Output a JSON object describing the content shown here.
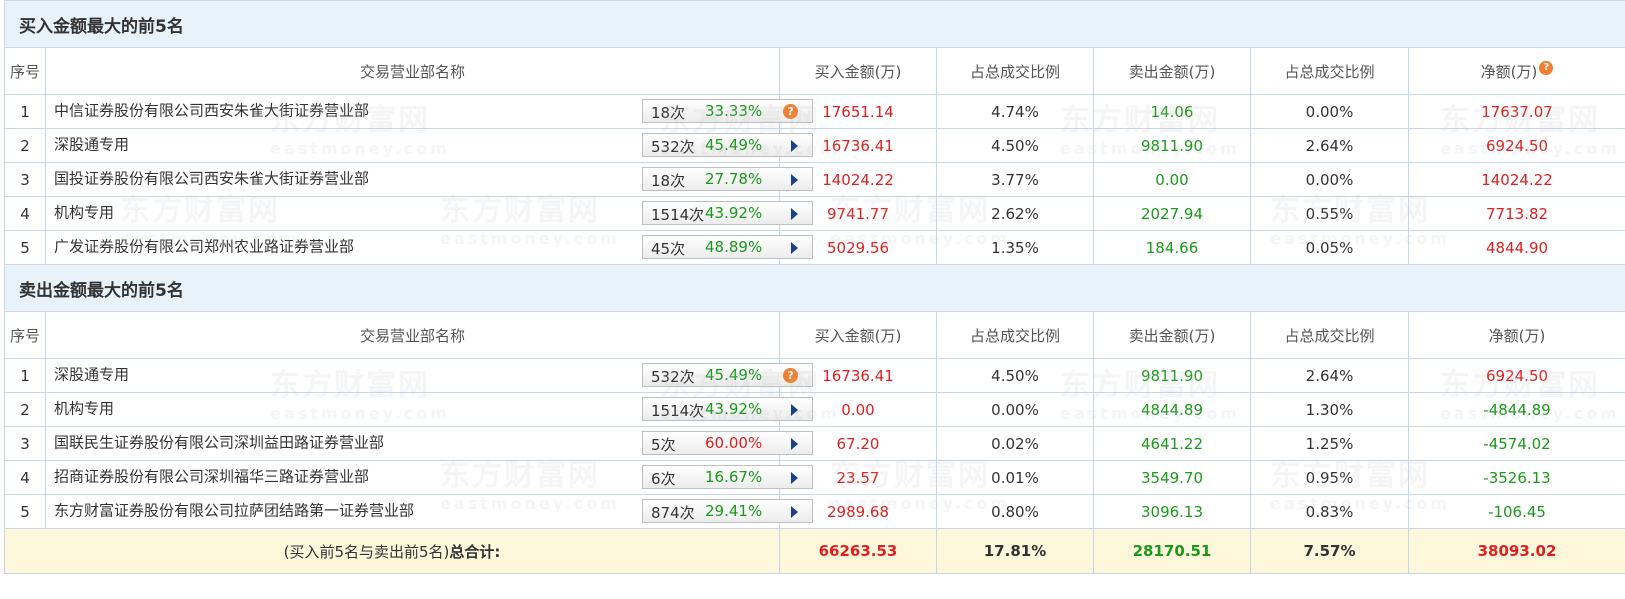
{
  "watermark": {
    "text": "东方财富网",
    "sub": "eastmoney.com"
  },
  "headers": [
    "序号",
    "交易营业部名称",
    "买入金额(万)",
    "占总成交比例",
    "卖出金额(万)",
    "占总成交比例",
    "净额(万)"
  ],
  "info_icon": "question-icon",
  "buy_section": {
    "title": "买入金额最大的前5名",
    "rows": [
      {
        "idx": "1",
        "name": "中信证券股份有限公司西安朱雀大街证券营业部",
        "count": "18次",
        "rate": "33.33%",
        "rate_color": "green",
        "icon": "question",
        "buy": "17651.14",
        "buy_ratio": "4.74%",
        "sell": "14.06",
        "sell_ratio": "0.00%",
        "net": "17637.07",
        "net_color": "red"
      },
      {
        "idx": "2",
        "name": "深股通专用",
        "count": "532次",
        "rate": "45.49%",
        "rate_color": "green",
        "icon": "arrow",
        "buy": "16736.41",
        "buy_ratio": "4.50%",
        "sell": "9811.90",
        "sell_ratio": "2.64%",
        "net": "6924.50",
        "net_color": "red"
      },
      {
        "idx": "3",
        "name": "国投证券股份有限公司西安朱雀大街证券营业部",
        "count": "18次",
        "rate": "27.78%",
        "rate_color": "green",
        "icon": "arrow",
        "buy": "14024.22",
        "buy_ratio": "3.77%",
        "sell": "0.00",
        "sell_ratio": "0.00%",
        "net": "14024.22",
        "net_color": "red"
      },
      {
        "idx": "4",
        "name": "机构专用",
        "count": "1514次",
        "rate": "43.92%",
        "rate_color": "green",
        "icon": "arrow",
        "buy": "9741.77",
        "buy_ratio": "2.62%",
        "sell": "2027.94",
        "sell_ratio": "0.55%",
        "net": "7713.82",
        "net_color": "red"
      },
      {
        "idx": "5",
        "name": "广发证券股份有限公司郑州农业路证券营业部",
        "count": "45次",
        "rate": "48.89%",
        "rate_color": "green",
        "icon": "arrow",
        "buy": "5029.56",
        "buy_ratio": "1.35%",
        "sell": "184.66",
        "sell_ratio": "0.05%",
        "net": "4844.90",
        "net_color": "red"
      }
    ]
  },
  "sell_section": {
    "title": "卖出金额最大的前5名",
    "rows": [
      {
        "idx": "1",
        "name": "深股通专用",
        "count": "532次",
        "rate": "45.49%",
        "rate_color": "green",
        "icon": "question",
        "buy": "16736.41",
        "buy_ratio": "4.50%",
        "sell": "9811.90",
        "sell_ratio": "2.64%",
        "net": "6924.50",
        "net_color": "red"
      },
      {
        "idx": "2",
        "name": "机构专用",
        "count": "1514次",
        "rate": "43.92%",
        "rate_color": "green",
        "icon": "arrow",
        "buy": "0.00",
        "buy_ratio": "0.00%",
        "sell": "4844.89",
        "sell_ratio": "1.30%",
        "net": "-4844.89",
        "net_color": "green"
      },
      {
        "idx": "3",
        "name": "国联民生证券股份有限公司深圳益田路证券营业部",
        "count": "5次",
        "rate": "60.00%",
        "rate_color": "red",
        "icon": "arrow",
        "buy": "67.20",
        "buy_ratio": "0.02%",
        "sell": "4641.22",
        "sell_ratio": "1.25%",
        "net": "-4574.02",
        "net_color": "green"
      },
      {
        "idx": "4",
        "name": "招商证券股份有限公司深圳福华三路证券营业部",
        "count": "6次",
        "rate": "16.67%",
        "rate_color": "green",
        "icon": "arrow",
        "buy": "23.57",
        "buy_ratio": "0.01%",
        "sell": "3549.70",
        "sell_ratio": "0.95%",
        "net": "-3526.13",
        "net_color": "green"
      },
      {
        "idx": "5",
        "name": "东方财富证券股份有限公司拉萨团结路第一证券营业部",
        "count": "874次",
        "rate": "29.41%",
        "rate_color": "green",
        "icon": "arrow",
        "buy": "2989.68",
        "buy_ratio": "0.80%",
        "sell": "3096.13",
        "sell_ratio": "0.83%",
        "net": "-106.45",
        "net_color": "green"
      }
    ]
  },
  "total": {
    "label_prefix": "(买入前5名与卖出前5名)",
    "label_bold": "总合计:",
    "buy": "66263.53",
    "buy_ratio": "17.81%",
    "sell": "28170.51",
    "sell_ratio": "7.57%",
    "net": "38093.02"
  }
}
